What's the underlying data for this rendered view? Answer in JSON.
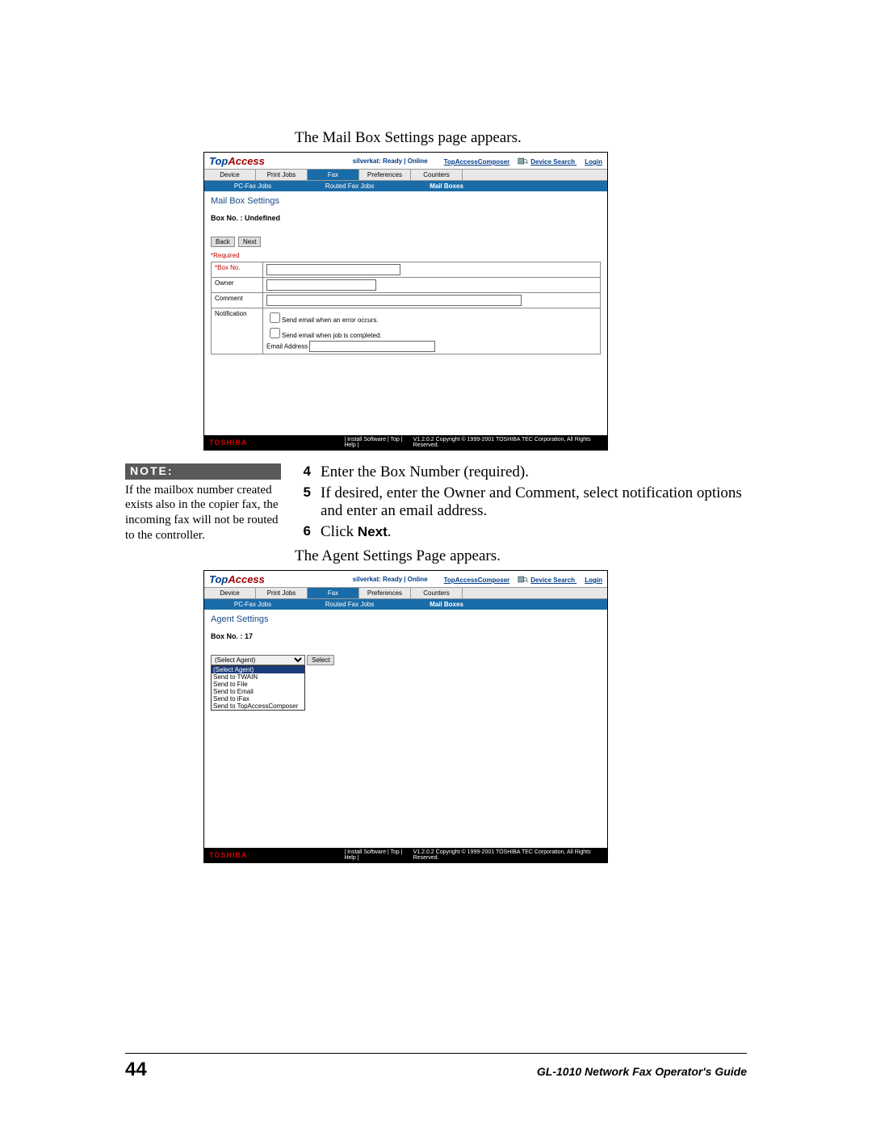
{
  "intro1": "The Mail Box Settings page appears.",
  "intro2": "The Agent Settings Page appears.",
  "note": {
    "head": "NOTE:",
    "body": "If the mailbox number created exists also in the copier fax, the incoming fax will not be routed to the controller."
  },
  "steps": {
    "s4": {
      "num": "4",
      "text": "Enter the Box Number (required)."
    },
    "s5": {
      "num": "5",
      "text": "If desired, enter the Owner and Comment, select notification options and enter an email address."
    },
    "s6": {
      "num": "6",
      "pre": "Click ",
      "bold": "Next",
      "post": "."
    }
  },
  "shot1": {
    "logo1": "Top",
    "logo2": "Access",
    "status": "silverkat: Ready | Online",
    "link_composer": "TopAccessComposer",
    "link_search": "Device Search",
    "link_login": "Login",
    "tabs": {
      "t1": "Device",
      "t2": "Print Jobs",
      "t3": "Fax",
      "t4": "Preferences",
      "t5": "Counters"
    },
    "subtabs": {
      "s1": "PC-Fax Jobs",
      "s2": "Routed Fax Jobs",
      "s3": "Mail Boxes"
    },
    "title": "Mail Box Settings",
    "boxline": "Box No. : Undefined",
    "btn_back": "Back",
    "btn_next": "Next",
    "req": "*Required",
    "row_box": "*Box No.",
    "row_owner": "Owner",
    "row_comment": "Comment",
    "row_notif": "Notification",
    "chk1": "Send email when an error occurs.",
    "chk2": "Send email when job is completed.",
    "email_lbl": "Email Address",
    "toshiba": "TOSHIBA",
    "flinks": "|  Install Software  |  Top  |  Help  |",
    "copyright": "V1.2.0.2  Copyright © 1999-2001 TOSHIBA TEC Corporation, All Rights Reserved."
  },
  "shot2": {
    "logo1": "Top",
    "logo2": "Access",
    "status": "silverkat: Ready | Online",
    "link_composer": "TopAccessComposer",
    "link_search": "Device Search",
    "link_login": "Login",
    "tabs": {
      "t1": "Device",
      "t2": "Print Jobs",
      "t3": "Fax",
      "t4": "Preferences",
      "t5": "Counters"
    },
    "subtabs": {
      "s1": "PC-Fax Jobs",
      "s2": "Routed Fax Jobs",
      "s3": "Mail Boxes"
    },
    "title": "Agent Settings",
    "boxline": "Box No. : 17",
    "sel_current": "(Select Agent)",
    "btn_select": "Select",
    "opts": {
      "o0": "(Select Agent)",
      "o1": "Send to TWAIN",
      "o2": "Send to File",
      "o3": "Send to Email",
      "o4": "Send to iFax",
      "o5": "Send to TopAccessComposer"
    },
    "toshiba": "TOSHIBA",
    "flinks": "|  Install Software  |  Top  |  Help  |",
    "copyright": "V1.2.0.2  Copyright © 1999-2001 TOSHIBA TEC Corporation, All Rights Reserved."
  },
  "footer": {
    "pagenum": "44",
    "guide": "GL-1010 Network Fax Operator's Guide"
  }
}
